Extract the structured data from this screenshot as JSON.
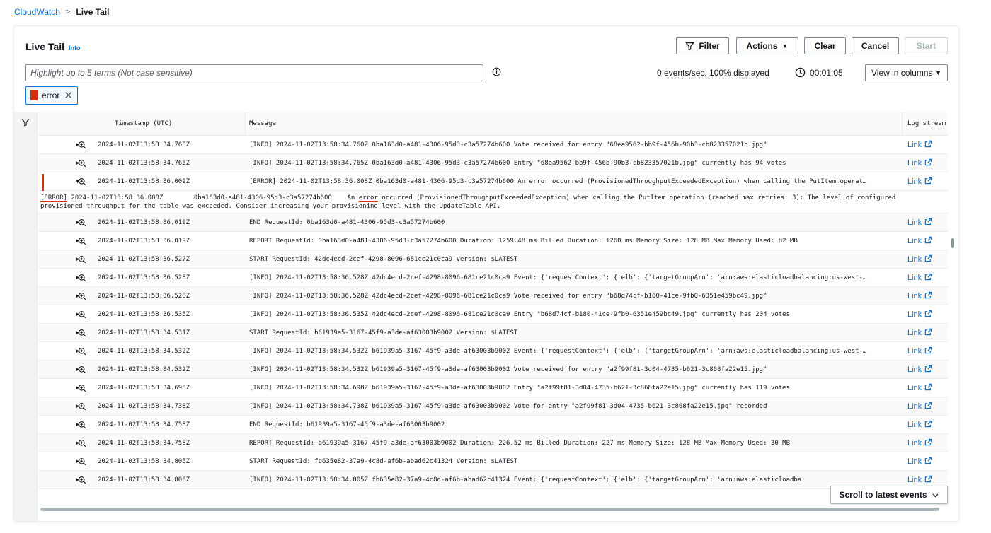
{
  "breadcrumb": {
    "root": "CloudWatch",
    "separator": ">",
    "current": "Live Tail"
  },
  "header": {
    "title": "Live Tail",
    "info": "Info"
  },
  "toolbar": {
    "filter": "Filter",
    "actions": "Actions",
    "clear": "Clear",
    "cancel": "Cancel",
    "start": "Start"
  },
  "search": {
    "placeholder": "Highlight up to 5 terms (Not case sensitive)"
  },
  "status": {
    "rate": "0 events/sec, 100% displayed",
    "elapsed": "00:01:05"
  },
  "view_select": {
    "value": "View in columns"
  },
  "highlight_terms": [
    {
      "term": "error",
      "color": "#d13212"
    }
  ],
  "table": {
    "headers": {
      "timestamp": "Timestamp (UTC)",
      "message": "Message",
      "log_stream": "Log stream"
    },
    "link_label": "Link",
    "rows": [
      {
        "ts": "2024-11-02T13:58:34.760Z",
        "msg": "[INFO] 2024-11-02T13:58:34.760Z 0ba163d0-a481-4306-95d3-c3a57274b600 Vote received for entry \"68ea9562-bb9f-456b-90b3-cb823357021b.jpg\""
      },
      {
        "ts": "2024-11-02T13:58:34.765Z",
        "msg": "[INFO] 2024-11-02T13:58:34.765Z 0ba163d0-a481-4306-95d3-c3a57274b600 Entry \"68ea9562-bb9f-456b-90b3-cb823357021b.jpg\" currently has 94 votes"
      },
      {
        "ts": "2024-11-02T13:58:36.009Z",
        "msg": "[ERROR] 2024-11-02T13:58:36.008Z 0ba163d0-a481-4306-95d3-c3a57274b600 An error occurred (ProvisionedThroughputExceededException) when calling the PutItem operat…",
        "expanded": true
      },
      {
        "ts": "2024-11-02T13:58:36.019Z",
        "msg": "END RequestId: 0ba163d0-a481-4306-95d3-c3a57274b600"
      },
      {
        "ts": "2024-11-02T13:58:36.019Z",
        "msg": "REPORT RequestId: 0ba163d0-a481-4306-95d3-c3a57274b600 Duration: 1259.48 ms Billed Duration: 1260 ms Memory Size: 128 MB Max Memory Used: 82 MB"
      },
      {
        "ts": "2024-11-02T13:58:36.527Z",
        "msg": "START RequestId: 42dc4ecd-2cef-4298-8096-681ce21c0ca9 Version: $LATEST"
      },
      {
        "ts": "2024-11-02T13:58:36.528Z",
        "msg": "[INFO] 2024-11-02T13:58:36.528Z 42dc4ecd-2cef-4298-8096-681ce21c0ca9 Event: {'requestContext': {'elb': {'targetGroupArn': 'arn:aws:elasticloadbalancing:us-west-…"
      },
      {
        "ts": "2024-11-02T13:58:36.528Z",
        "msg": "[INFO] 2024-11-02T13:58:36.528Z 42dc4ecd-2cef-4298-8096-681ce21c0ca9 Vote received for entry \"b68d74cf-b180-41ce-9fb0-6351e459bc49.jpg\""
      },
      {
        "ts": "2024-11-02T13:58:36.535Z",
        "msg": "[INFO] 2024-11-02T13:58:36.535Z 42dc4ecd-2cef-4298-8096-681ce21c0ca9 Entry \"b68d74cf-b180-41ce-9fb0-6351e459bc49.jpg\" currently has 204 votes"
      },
      {
        "ts": "2024-11-02T13:58:34.531Z",
        "msg": "START RequestId: b61939a5-3167-45f9-a3de-af63003b9002 Version: $LATEST"
      },
      {
        "ts": "2024-11-02T13:58:34.532Z",
        "msg": "[INFO] 2024-11-02T13:58:34.532Z b61939a5-3167-45f9-a3de-af63003b9002 Event: {'requestContext': {'elb': {'targetGroupArn': 'arn:aws:elasticloadbalancing:us-west-…"
      },
      {
        "ts": "2024-11-02T13:58:34.532Z",
        "msg": "[INFO] 2024-11-02T13:58:34.532Z b61939a5-3167-45f9-a3de-af63003b9002 Vote received for entry \"a2f99f81-3d04-4735-b621-3c868fa22e15.jpg\""
      },
      {
        "ts": "2024-11-02T13:58:34.698Z",
        "msg": "[INFO] 2024-11-02T13:58:34.698Z b61939a5-3167-45f9-a3de-af63003b9002 Entry \"a2f99f81-3d04-4735-b621-3c868fa22e15.jpg\" currently has 119 votes"
      },
      {
        "ts": "2024-11-02T13:58:34.738Z",
        "msg": "[INFO] 2024-11-02T13:58:34.738Z b61939a5-3167-45f9-a3de-af63003b9002 Vote for entry \"a2f99f81-3d04-4735-b621-3c868fa22e15.jpg\" recorded"
      },
      {
        "ts": "2024-11-02T13:58:34.758Z",
        "msg": "END RequestId: b61939a5-3167-45f9-a3de-af63003b9002"
      },
      {
        "ts": "2024-11-02T13:58:34.758Z",
        "msg": "REPORT RequestId: b61939a5-3167-45f9-a3de-af63003b9002 Duration: 226.52 ms Billed Duration: 227 ms Memory Size: 128 MB Max Memory Used: 30 MB"
      },
      {
        "ts": "2024-11-02T13:58:34.805Z",
        "msg": "START RequestId: fb635e82-37a9-4c8d-af6b-abad62c41324 Version: $LATEST"
      },
      {
        "ts": "2024-11-02T13:58:34.806Z",
        "msg": "[INFO] 2024-11-02T13:58:34.805Z fb635e82-37a9-4c8d-af6b-abad62c41324 Event: {'requestContext': {'elb': {'targetGroupArn': 'arn:aws:elasticloadba"
      }
    ],
    "expanded_detail": {
      "level": "[ERROR]",
      "line1_a": " 2024-11-02T13:58:36.008Z        0ba163d0-a481-4306-95d3-c3a57274b600    An ",
      "term": "error",
      "line1_b": " occurred (ProvisionedThroughputExceededException) when calling the PutItem operation (reached max retries: 3): The level of configured",
      "line2": "provisioned throughput for the table was exceeded. Consider increasing your provisioning level with the UpdateTable API."
    }
  },
  "scroll_latest": "Scroll to latest events"
}
